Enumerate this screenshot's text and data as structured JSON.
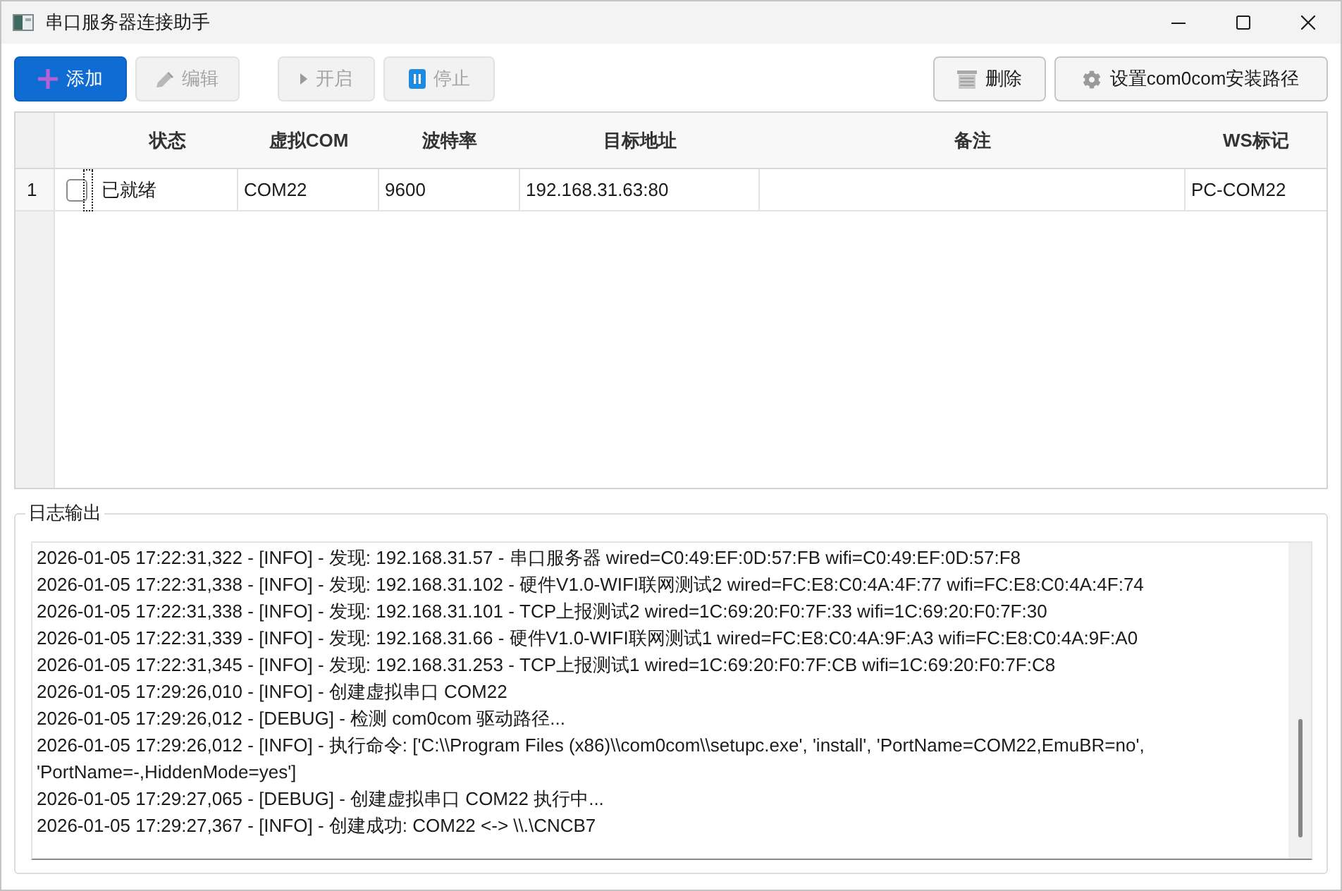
{
  "window": {
    "title": "串口服务器连接助手"
  },
  "toolbar": {
    "left": [
      {
        "kind": "add",
        "label": "添加",
        "disabled": false
      },
      {
        "kind": "edit",
        "label": "编辑",
        "disabled": true
      }
    ],
    "middle": [
      {
        "kind": "start",
        "label": "开启",
        "disabled": true
      },
      {
        "kind": "stop",
        "label": "停止",
        "disabled": true
      }
    ],
    "right": [
      {
        "kind": "delete",
        "label": "删除",
        "disabled": false
      },
      {
        "kind": "settings",
        "label": "设置com0com安装路径",
        "disabled": false
      }
    ]
  },
  "table": {
    "columns": [
      "状态",
      "虚拟COM",
      "波特率",
      "目标地址",
      "备注",
      "WS标记"
    ],
    "rows": [
      {
        "number": "1",
        "checked": false,
        "focused": true,
        "status": "已就绪",
        "virtual_com": "COM22",
        "baud_rate": "9600",
        "target_address": "192.168.31.63:80",
        "ws_tag": "PC-COM22"
      }
    ]
  },
  "log": {
    "title": "日志输出",
    "lines": [
      "2026-01-05 17:22:31,322 - [INFO] - 发现: 192.168.31.57 - 串口服务器 wired=C0:49:EF:0D:57:FB wifi=C0:49:EF:0D:57:F8",
      "2026-01-05 17:22:31,338 - [INFO] - 发现: 192.168.31.102 - 硬件V1.0-WIFI联网测试2 wired=FC:E8:C0:4A:4F:77 wifi=FC:E8:C0:4A:4F:74",
      "2026-01-05 17:22:31,338 - [INFO] - 发现: 192.168.31.101 - TCP上报测试2 wired=1C:69:20:F0:7F:33 wifi=1C:69:20:F0:7F:30",
      "2026-01-05 17:22:31,339 - [INFO] - 发现: 192.168.31.66 - 硬件V1.0-WIFI联网测试1 wired=FC:E8:C0:4A:9F:A3 wifi=FC:E8:C0:4A:9F:A0",
      "2026-01-05 17:22:31,345 - [INFO] - 发现: 192.168.31.253 - TCP上报测试1 wired=1C:69:20:F0:7F:CB wifi=1C:69:20:F0:7F:C8",
      "2026-01-05 17:29:26,010 - [INFO] - 创建虚拟串口 COM22",
      "2026-01-05 17:29:26,012 - [DEBUG] - 检测 com0com 驱动路径...",
      "2026-01-05 17:29:26,012 - [INFO] - 执行命令: ['C:\\\\Program Files (x86)\\\\com0com\\\\setupc.exe', 'install', 'PortName=COM22,EmuBR=no', 'PortName=-,HiddenMode=yes']",
      "2026-01-05 17:29:27,065 - [DEBUG] - 创建虚拟串口 COM22 执行中...",
      "2026-01-05 17:29:27,367 - [INFO] - 创建成功: COM22 <-> \\\\.\\CNCB7"
    ]
  }
}
